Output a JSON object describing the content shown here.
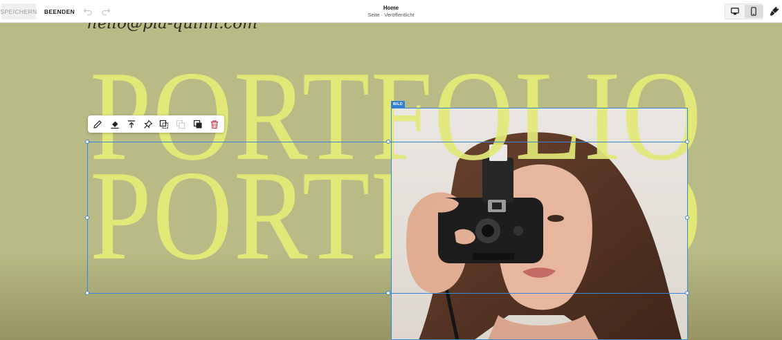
{
  "topbar": {
    "save_label": "SPEICHERN",
    "exit_label": "BEENDEN",
    "page_title": "Home",
    "page_status": "Seite · Veröffentlicht",
    "icons": [
      "undo-icon",
      "redo-icon",
      "desktop-icon",
      "mobile-icon",
      "paintbrush-icon"
    ]
  },
  "canvas": {
    "email": "hello@pia-quinn.com",
    "headline_1": "PORTFOLIO",
    "headline_2": "PORTFOLIO",
    "selected_block_label": "BILD",
    "colors": {
      "background": "#b8bb85",
      "headline": "#e2e878",
      "selection": "#3a86d6"
    }
  },
  "toolbar": {
    "icons": [
      "edit-pencil-icon",
      "fill-bucket-icon",
      "move-to-top-icon",
      "pin-icon",
      "bring-forward-icon",
      "send-backward-icon",
      "duplicate-icon",
      "delete-trash-icon"
    ]
  }
}
